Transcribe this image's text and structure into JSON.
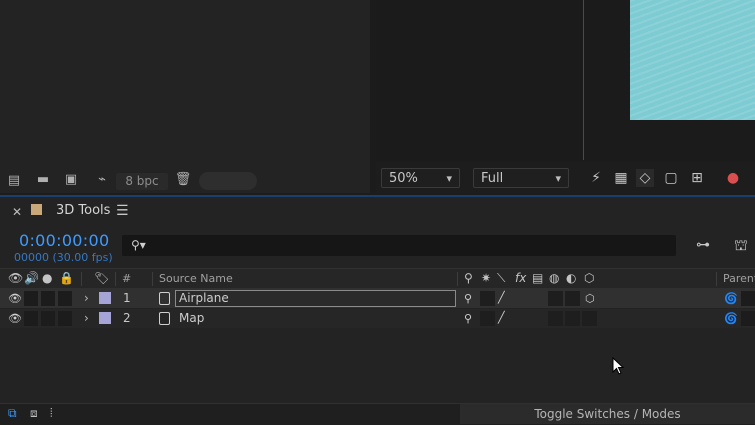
{
  "project": {
    "bpc_label": "8 bpc"
  },
  "viewer": {
    "zoom": "50%",
    "resolution": "Full",
    "image_color": "#7dcbd3"
  },
  "timeline": {
    "tab_title": "3D Tools",
    "tab_color": "#c9a87a",
    "timecode": "0:00:00:00",
    "frame_fps": "00000 (30.00 fps)",
    "search_placeholder": "",
    "columns": {
      "number": "#",
      "source_name": "Source Name",
      "fx": "fx",
      "parent": "Parent"
    },
    "layers": [
      {
        "number": "1",
        "name": "Airplane",
        "label_color": "#a6a4d6",
        "selected": true
      },
      {
        "number": "2",
        "name": "Map",
        "label_color": "#a6a4d6",
        "selected": false
      }
    ],
    "toggle_label": "Toggle Switches / Modes",
    "accent": "#3f9bff"
  }
}
